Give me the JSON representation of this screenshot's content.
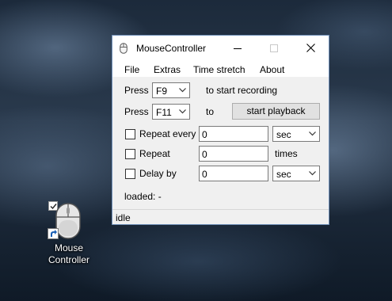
{
  "desktop": {
    "icon_label_line1": "Mouse",
    "icon_label_line2": "Controller"
  },
  "window": {
    "title": "MouseController",
    "menu": [
      "File",
      "Extras",
      "Time stretch",
      "About"
    ],
    "record_row": {
      "press_label": "Press",
      "key_value": "F9",
      "suffix": "to start recording"
    },
    "playback_row": {
      "press_label": "Press",
      "key_value": "F11",
      "to_label": "to",
      "button_label": "start playback"
    },
    "repeat_every": {
      "checked": false,
      "label": "Repeat every",
      "value": "0",
      "unit_value": "sec"
    },
    "repeat": {
      "checked": false,
      "label": "Repeat",
      "value": "0",
      "unit": "times"
    },
    "delay_by": {
      "checked": false,
      "label": "Delay by",
      "value": "0",
      "unit_value": "sec"
    },
    "loaded_text": "loaded: -",
    "status": "idle"
  },
  "icons": {
    "app": "mouse-icon",
    "minimize": "minimize-icon",
    "maximize": "maximize-icon",
    "close": "close-icon",
    "dropdown": "chevron-down-icon",
    "shortcut": "shortcut-arrow-icon",
    "selected": "checkmark-icon"
  },
  "colors": {
    "window_border": "#6f8fb8",
    "desktop": "#1c2a3b",
    "button_face": "#e1e1e1"
  }
}
